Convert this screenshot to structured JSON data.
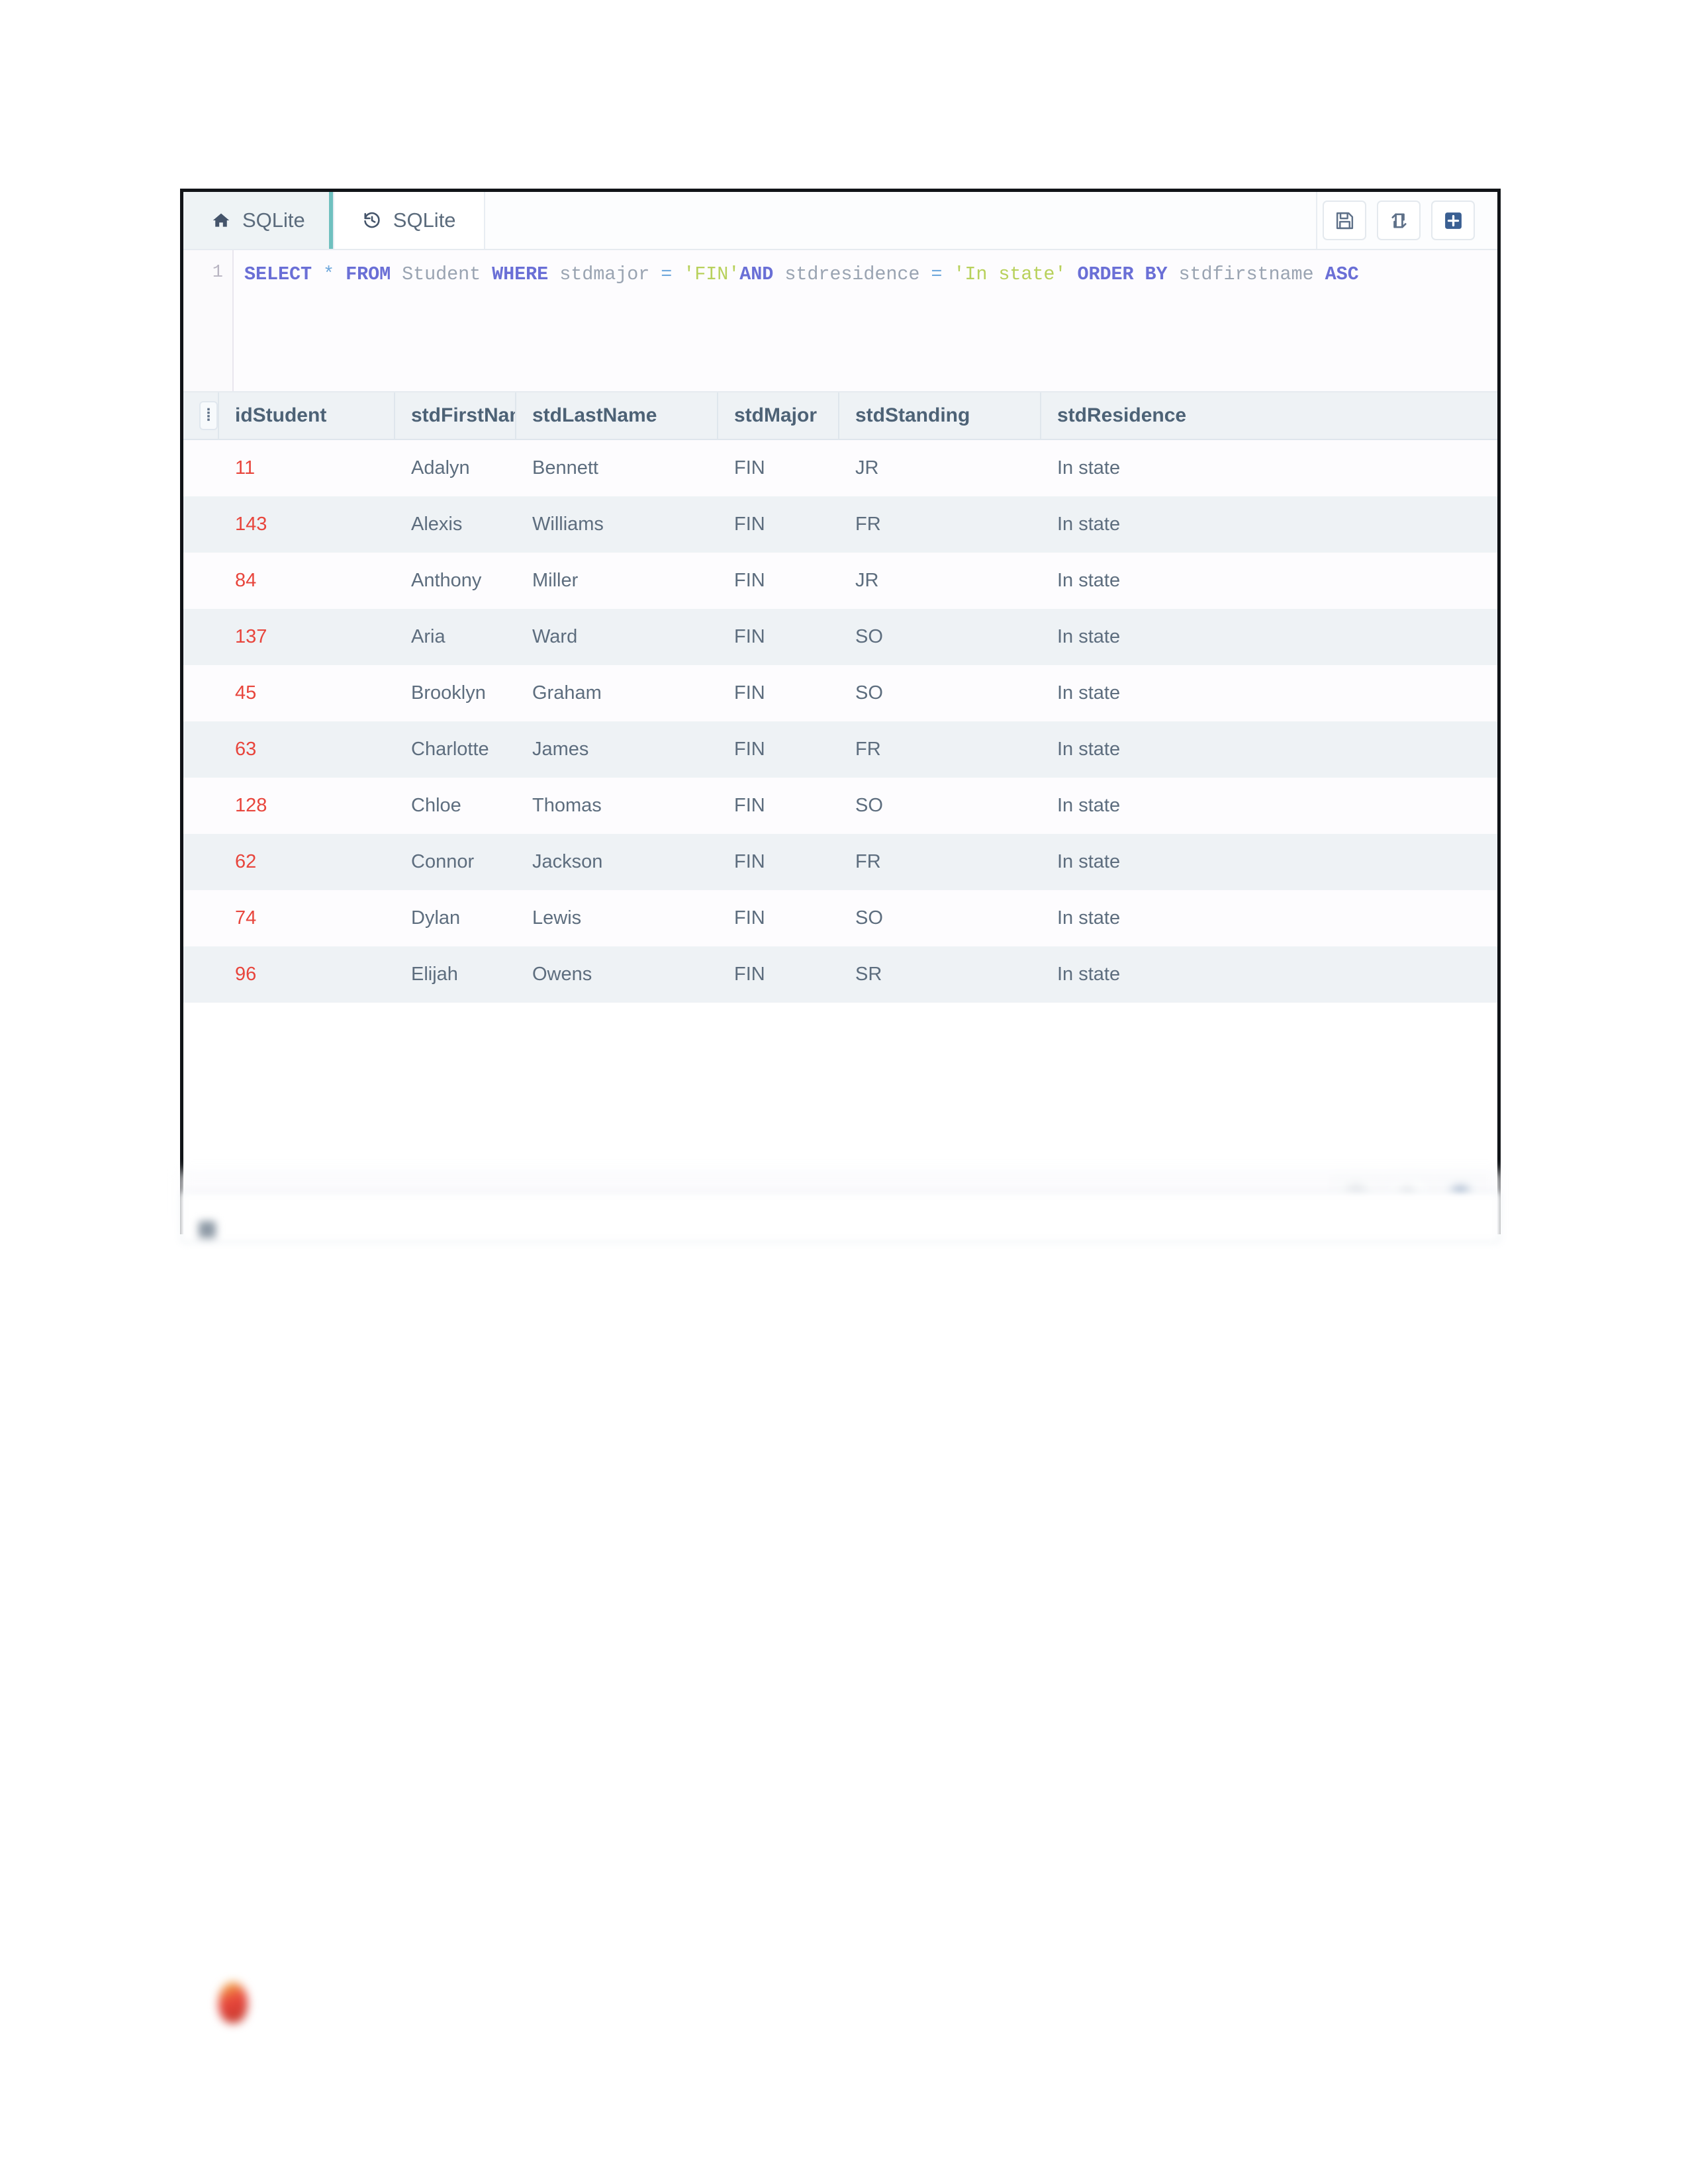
{
  "app": {
    "tabs": [
      {
        "label": "SQLite",
        "icon": "home-icon",
        "active": true
      },
      {
        "label": "SQLite",
        "icon": "history-icon",
        "active": false
      }
    ],
    "toolbar": {
      "save_label": "save-icon",
      "refresh_label": "exchange-icon",
      "add_label": "add-icon"
    },
    "editor": {
      "line_number": "1",
      "query": "SELECT * FROM Student WHERE stdmajor = 'FIN'AND stdresidence = 'In state' ORDER BY stdfirstname ASC",
      "tokens": [
        {
          "t": "SELECT",
          "c": "kw"
        },
        {
          "t": " ",
          "c": "punc"
        },
        {
          "t": "*",
          "c": "op"
        },
        {
          "t": " ",
          "c": "punc"
        },
        {
          "t": "FROM",
          "c": "kw"
        },
        {
          "t": " ",
          "c": "punc"
        },
        {
          "t": "Student",
          "c": "id"
        },
        {
          "t": " ",
          "c": "punc"
        },
        {
          "t": "WHERE",
          "c": "kw"
        },
        {
          "t": " ",
          "c": "punc"
        },
        {
          "t": "stdmajor",
          "c": "id"
        },
        {
          "t": " ",
          "c": "punc"
        },
        {
          "t": "=",
          "c": "op"
        },
        {
          "t": " ",
          "c": "punc"
        },
        {
          "t": "'FIN'",
          "c": "str"
        },
        {
          "t": "AND",
          "c": "kw"
        },
        {
          "t": " ",
          "c": "punc"
        },
        {
          "t": "stdresidence",
          "c": "id"
        },
        {
          "t": " ",
          "c": "punc"
        },
        {
          "t": "=",
          "c": "op"
        },
        {
          "t": " ",
          "c": "punc"
        },
        {
          "t": "'In state'",
          "c": "str"
        },
        {
          "t": " ",
          "c": "punc"
        },
        {
          "t": "ORDER",
          "c": "kw"
        },
        {
          "t": " ",
          "c": "punc"
        },
        {
          "t": "BY",
          "c": "kw"
        },
        {
          "t": " ",
          "c": "punc"
        },
        {
          "t": "stdfirstname",
          "c": "id"
        },
        {
          "t": " ",
          "c": "punc"
        },
        {
          "t": "ASC",
          "c": "kw"
        }
      ]
    }
  },
  "results": {
    "row_menu_icon": "column-menu-icon",
    "columns": [
      "idStudent",
      "stdFirstName",
      "stdLastName",
      "stdMajor",
      "stdStanding",
      "stdResidence"
    ],
    "rows": [
      {
        "idStudent": "11",
        "stdFirstName": "Adalyn",
        "stdLastName": "Bennett",
        "stdMajor": "FIN",
        "stdStanding": "JR",
        "stdResidence": "In state"
      },
      {
        "idStudent": "143",
        "stdFirstName": "Alexis",
        "stdLastName": "Williams",
        "stdMajor": "FIN",
        "stdStanding": "FR",
        "stdResidence": "In state"
      },
      {
        "idStudent": "84",
        "stdFirstName": "Anthony",
        "stdLastName": "Miller",
        "stdMajor": "FIN",
        "stdStanding": "JR",
        "stdResidence": "In state"
      },
      {
        "idStudent": "137",
        "stdFirstName": "Aria",
        "stdLastName": "Ward",
        "stdMajor": "FIN",
        "stdStanding": "SO",
        "stdResidence": "In state"
      },
      {
        "idStudent": "45",
        "stdFirstName": "Brooklyn",
        "stdLastName": "Graham",
        "stdMajor": "FIN",
        "stdStanding": "SO",
        "stdResidence": "In state"
      },
      {
        "idStudent": "63",
        "stdFirstName": "Charlotte",
        "stdLastName": "James",
        "stdMajor": "FIN",
        "stdStanding": "FR",
        "stdResidence": "In state"
      },
      {
        "idStudent": "128",
        "stdFirstName": "Chloe",
        "stdLastName": "Thomas",
        "stdMajor": "FIN",
        "stdStanding": "SO",
        "stdResidence": "In state"
      },
      {
        "idStudent": "62",
        "stdFirstName": "Connor",
        "stdLastName": "Jackson",
        "stdMajor": "FIN",
        "stdStanding": "FR",
        "stdResidence": "In state"
      },
      {
        "idStudent": "74",
        "stdFirstName": "Dylan",
        "stdLastName": "Lewis",
        "stdMajor": "FIN",
        "stdStanding": "SO",
        "stdResidence": "In state"
      },
      {
        "idStudent": "96",
        "stdFirstName": "Elijah",
        "stdLastName": "Owens",
        "stdMajor": "FIN",
        "stdStanding": "SR",
        "stdResidence": "In state"
      }
    ],
    "partial_row": {
      "idStudent": "",
      "stdFirstName": "",
      "stdLastName": "",
      "stdMajor": "",
      "stdStanding": "",
      "stdResidence": ""
    }
  },
  "colors": {
    "accent_teal": "#6fc0bf",
    "id_red": "#e8453c",
    "header_bg": "#eef2f5",
    "row_alt_bg": "#eef2f5",
    "text": "#5d6d7e",
    "keyword": "#6a6fd6",
    "string": "#b8d15c"
  }
}
